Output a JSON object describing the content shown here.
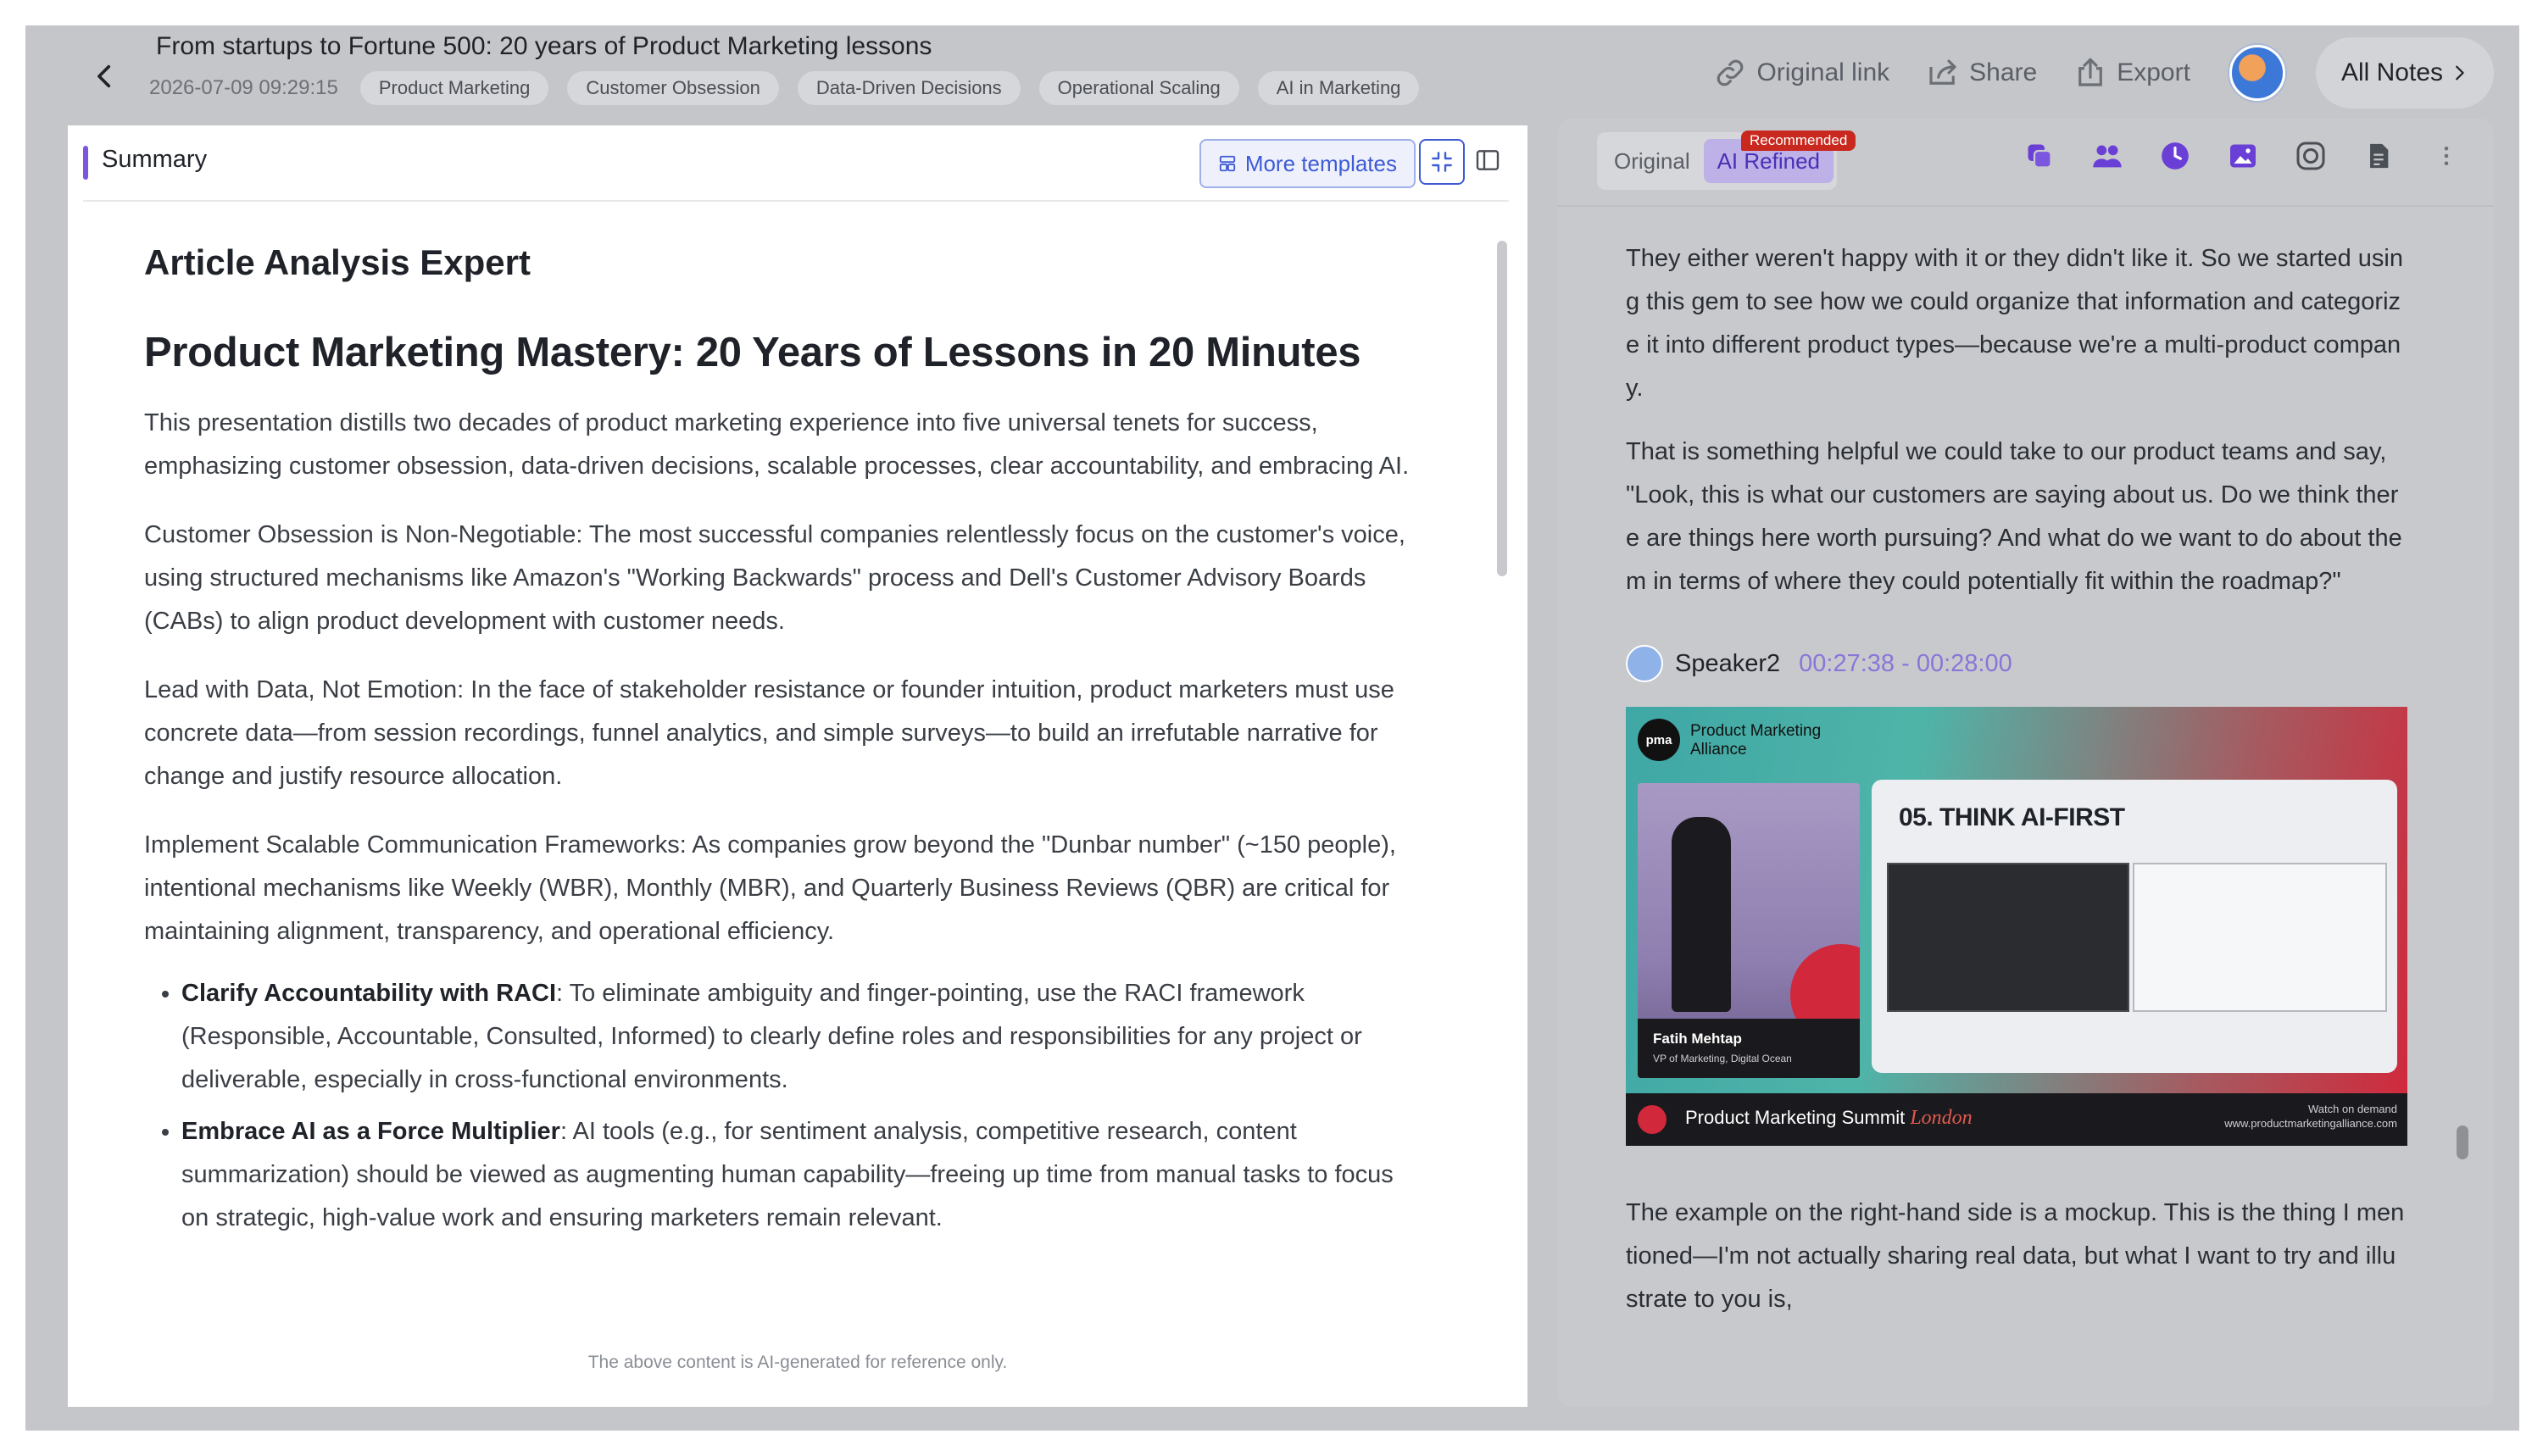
{
  "header": {
    "title": "From startups to Fortune 500: 20 years of Product Marketing lessons",
    "date": "2026-07-09 09:29:15",
    "tags": [
      "Product Marketing",
      "Customer Obsession",
      "Data-Driven Decisions",
      "Operational Scaling",
      "AI in Marketing"
    ],
    "original_link": "Original link",
    "share": "Share",
    "export": "Export",
    "all_notes": "All Notes"
  },
  "summary": {
    "panel_title": "Summary",
    "more_templates": "More templates",
    "expert_title": "Article Analysis Expert",
    "main_title": "Product Marketing Mastery: 20 Years of Lessons in 20 Minutes",
    "paragraphs": [
      "This presentation distills two decades of product marketing experience into five universal tenets for success, emphasizing customer obsession, data-driven decisions, scalable processes, clear accountability, and embracing AI.",
      "Customer Obsession is Non-Negotiable: The most successful companies relentlessly focus on the customer's voice, using structured mechanisms like Amazon's \"Working Backwards\" process and Dell's Customer Advisory Boards (CABs) to align product development with customer needs.",
      "Lead with Data, Not Emotion: In the face of stakeholder resistance or founder intuition, product marketers must use concrete data—from session recordings, funnel analytics, and simple surveys—to build an irrefutable narrative for change and justify resource allocation.",
      "Implement Scalable Communication Frameworks: As companies grow beyond the \"Dunbar number\" (~150 people), intentional mechanisms like Weekly (WBR), Monthly (MBR), and Quarterly Business Reviews (QBR) are critical for maintaining alignment, transparency, and operational efficiency."
    ],
    "bullets": [
      {
        "bold": "Clarify Accountability with RACI",
        "text": ": To eliminate ambiguity and finger-pointing, use the RACI framework (Responsible, Accountable, Consulted, Informed) to clearly define roles and responsibilities for any project or deliverable, especially in cross-functional environments."
      },
      {
        "bold": "Embrace AI as a Force Multiplier",
        "text": ": AI tools (e.g., for sentiment analysis, competitive research, content summarization) should be viewed as augmenting human capability—freeing up time from manual tasks to focus on strategic, high-value work and ensuring marketers remain relevant."
      }
    ],
    "disclaimer": "The above content is AI-generated for reference only."
  },
  "transcript": {
    "tab_original": "Original",
    "tab_refined": "AI Refined",
    "recommended_badge": "Recommended",
    "para1": "They either weren't happy with it or they didn't like it. So we started using this gem to see how we could organize that information and categorize it into different product types—because we're a multi-product company.",
    "para2": "That is something helpful we could take to our product teams and say, \"Look, this is what our customers are saying about us. Do we think there are things here worth pursuing? And what do we want to do about them in terms of where they could potentially fit within the roadmap?\"",
    "speaker_name": "Speaker2",
    "speaker_time": "00:27:38 - 00:28:00",
    "slide": {
      "logo": "pma",
      "brand": "Product Marketing\nAlliance",
      "heading": "05.  THINK AI-FIRST",
      "presenter_name": "Fatih Mehtap",
      "presenter_role": "VP of Marketing, Digital Ocean",
      "summit": "Product Marketing Summit",
      "city": "London",
      "watch": "Watch on demand",
      "url": "www.productmarketingalliance.com"
    },
    "para3": "The example on the right-hand side is a mockup. This is the thing I mentioned—I'm not actually sharing real data, but what I want to try and illustrate to you is,"
  },
  "colors": {
    "accent": "#7b57e0",
    "link_blue": "#3f5bd4",
    "recommended_red": "#c9281e",
    "speaker_time": "#8a75d9"
  }
}
